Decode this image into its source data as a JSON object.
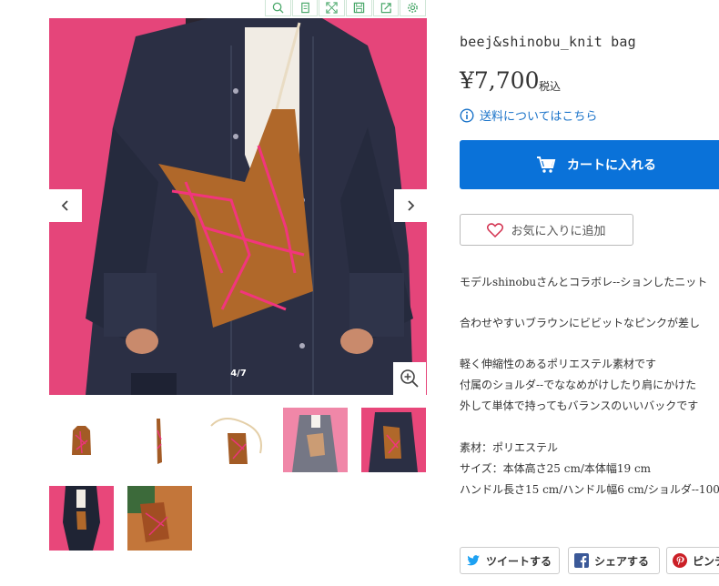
{
  "toolbar": {
    "icons": [
      "search-icon",
      "copy-icon",
      "expand-icon",
      "save-icon",
      "share-out-icon",
      "gear-icon"
    ]
  },
  "gallery": {
    "counter": "4/7",
    "icons": {
      "prev": "chevron-left-icon",
      "next": "chevron-right-icon",
      "zoom": "zoom-in-icon"
    }
  },
  "product": {
    "title": "beej&shinobu_knit bag",
    "price": "¥7,700",
    "tax_label": "税込",
    "shipping_link": "送料についてはこちら",
    "cart_button": "カートに入れる",
    "favorite_button": "お気に入りに追加"
  },
  "description": {
    "line1": "モデルshinobuさんとコラボレ--ションしたニット",
    "line2": "合わせやすいブラウンにビビットなピンクが差し",
    "line3": "軽く伸縮性のあるポリエステル素材です",
    "line4": "付属のショルダ--でななめがけしたり肩にかけた",
    "line5": "外して単体で持ってもバランスのいいバックです",
    "line6": "素材：ポリエステル",
    "line7": "サイズ：本体高さ25 cm/本体幅19 cm",
    "line8": "ハンドル長さ15 cm/ハンドル幅6 cm/ショルダ--100"
  },
  "share": {
    "tweet": "ツイートする",
    "facebook": "シェアする",
    "pinterest": "ピンテ"
  },
  "colors": {
    "accent": "#0a72d9",
    "link": "#1a73c9",
    "pink_background": "#e8477a",
    "denim": "#2b2f44",
    "bag_brown": "#b0682a",
    "bag_pattern": "#f2357d"
  }
}
